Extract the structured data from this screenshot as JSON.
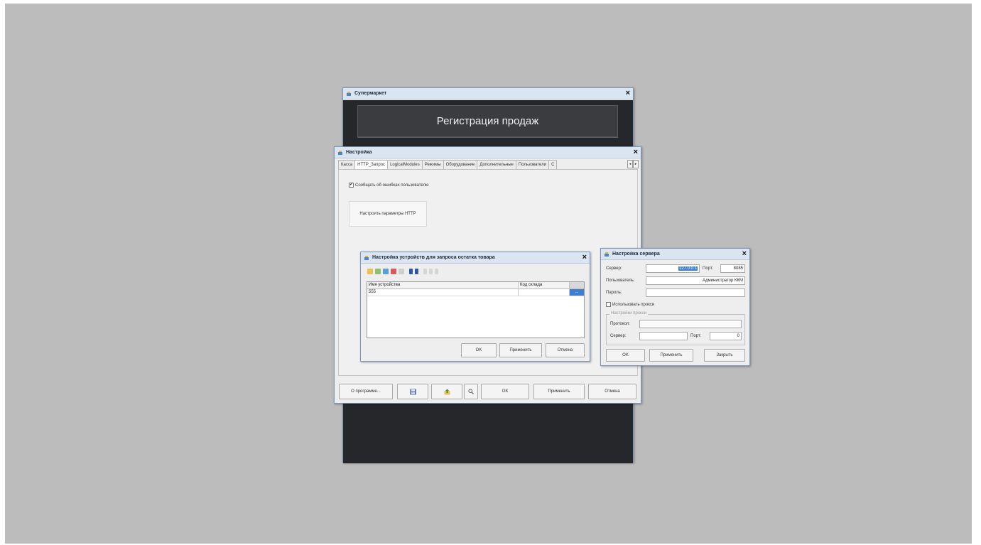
{
  "super_window": {
    "title": "Супермаркет",
    "banner": "Регистрация продаж",
    "close": "×"
  },
  "settings_window": {
    "title": "Настройка",
    "close": "×",
    "tabs": [
      "Касса",
      "HTTP_Запрос",
      "LogicalModules",
      "Режимы",
      "Оборудование",
      "Дополнительные",
      "Пользователи",
      "С"
    ],
    "tab_scroll_left": "◂",
    "tab_scroll_right": "▸",
    "checkbox_mark": "✔",
    "checkbox_label": "Сообщать об ошибках пользователю",
    "http_button": "Настроить параметры HTTP",
    "bottom_buttons": {
      "about": "О программе...",
      "ok": "OK",
      "apply": "Применить",
      "cancel": "Отмена"
    }
  },
  "device_window": {
    "title": "Настройка устройств для запроса остатка товара",
    "close": "×",
    "columns": [
      "Имя устройства",
      "Код склада"
    ],
    "rows": [
      [
        "555",
        ""
      ]
    ],
    "ellipsis": "...",
    "buttons": {
      "ok": "OK",
      "apply": "Применить",
      "cancel": "Отмена"
    }
  },
  "server_window": {
    "title": "Настройка сервера",
    "close": "×",
    "server_label": "Сервер:",
    "server_value": "127.0.0.1",
    "port_label": "Порт:",
    "port_value": "8085",
    "user_label": "Пользователь:",
    "user_value": "Администратор ККМ",
    "password_label": "Пароль:",
    "password_value": "",
    "use_proxy_label": "Использовать прокси",
    "proxy_group_title": "Настройки прокси",
    "protocol_label": "Протокол:",
    "proxy_server_label": "Сервер:",
    "proxy_port_label": "Порт:",
    "proxy_port_value": "0",
    "buttons": {
      "ok": "OK",
      "apply": "Применить",
      "close": "Закрыть"
    }
  },
  "colors": {
    "desktop": "#bcbcbc",
    "titlebar": "#dbe5f1",
    "super_body": "#25272b",
    "selection": "#3c7fd1"
  }
}
